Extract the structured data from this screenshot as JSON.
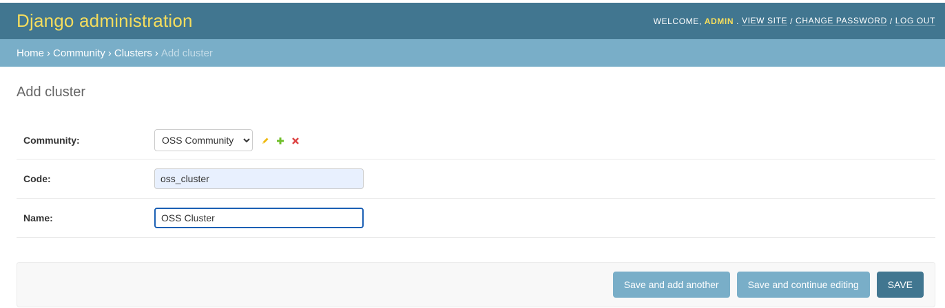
{
  "header": {
    "site_name": "Django administration",
    "welcome_text": "Welcome,",
    "user": "admin",
    "view_site": "View site",
    "change_password": "Change password",
    "log_out": "Log out",
    "separator": "/"
  },
  "breadcrumbs": {
    "home": "Home",
    "app": "Community",
    "model": "Clusters",
    "current": "Add cluster",
    "separator": "›"
  },
  "page": {
    "title": "Add cluster"
  },
  "form": {
    "community": {
      "label": "Community:",
      "selected": "OSS Community"
    },
    "code": {
      "label": "Code:",
      "value": "oss_cluster"
    },
    "name": {
      "label": "Name:",
      "value": "OSS Cluster"
    }
  },
  "actions": {
    "save_add_another": "Save and add another",
    "save_continue": "Save and continue editing",
    "save": "Save"
  },
  "colors": {
    "header_bg": "#417690",
    "breadcrumb_bg": "#79aec8",
    "brand": "#f5dd5d",
    "edit_icon": "#efb80b",
    "add_icon": "#70bf2b",
    "delete_icon": "#dd4646"
  },
  "icons": [
    "pencil-icon",
    "plus-icon",
    "delete-x-icon"
  ]
}
